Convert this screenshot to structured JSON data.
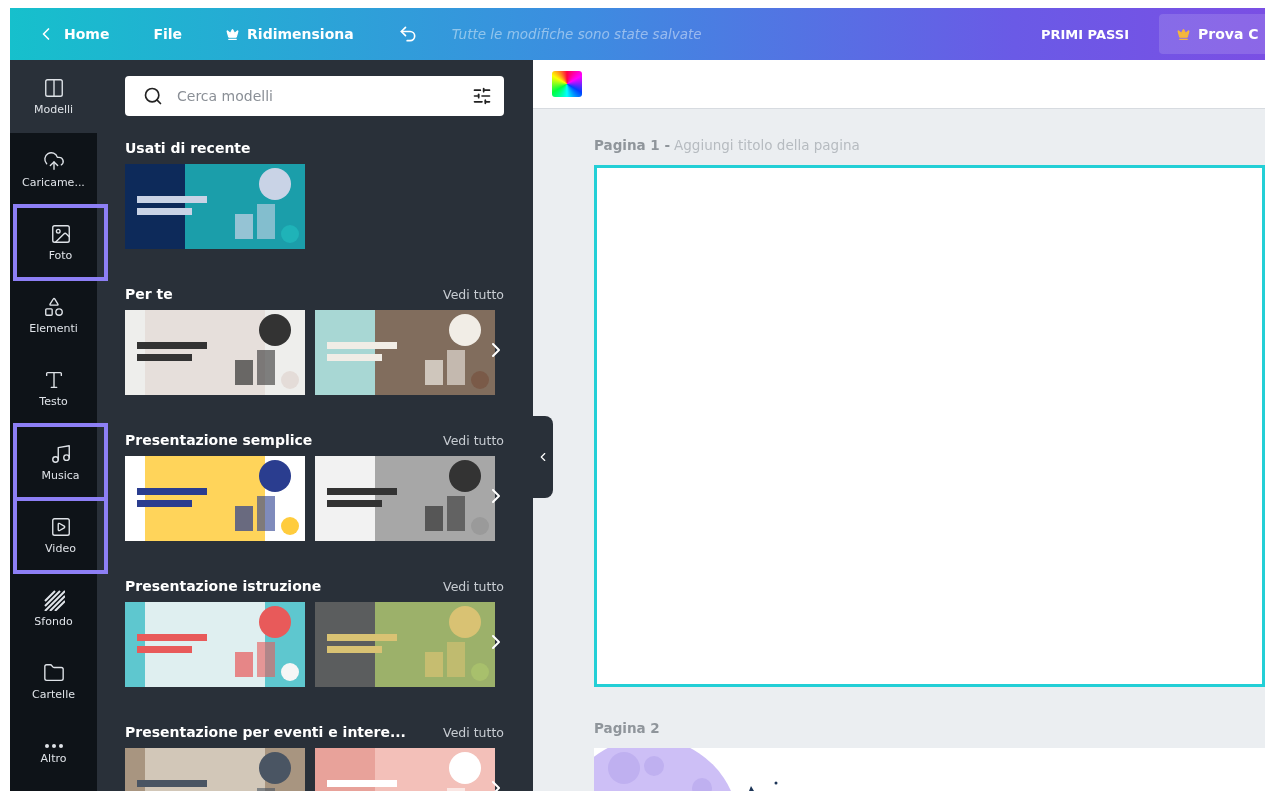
{
  "top_bar": {
    "back": "Home",
    "menu": [
      {
        "label": "File",
        "kind": "plain"
      },
      {
        "label": "Ridimensiona",
        "kind": "premium"
      }
    ],
    "status": "Tutte le modifiche sono state salvate",
    "help": "PRIMI PASSI",
    "trial": "Prova C"
  },
  "sidebar": {
    "items": [
      {
        "label": "Modelli",
        "kind": "templates",
        "selected": true,
        "highlighted": false
      },
      {
        "label": "Caricame...",
        "kind": "uploads",
        "selected": false,
        "highlighted": false
      },
      {
        "label": "Foto",
        "kind": "photos",
        "selected": false,
        "highlighted": true
      },
      {
        "label": "Elementi",
        "kind": "elements",
        "selected": false,
        "highlighted": false
      },
      {
        "label": "Testo",
        "kind": "text",
        "selected": false,
        "highlighted": false
      },
      {
        "label": "Musica",
        "kind": "music",
        "selected": false,
        "highlighted": true
      },
      {
        "label": "Video",
        "kind": "video",
        "selected": false,
        "highlighted": true
      },
      {
        "label": "Sfondo",
        "kind": "background",
        "selected": false,
        "highlighted": false
      },
      {
        "label": "Cartelle",
        "kind": "folders",
        "selected": false,
        "highlighted": false
      },
      {
        "label": "Altro",
        "kind": "more",
        "selected": false,
        "highlighted": false
      }
    ]
  },
  "panel": {
    "search": {
      "placeholder": "Cerca modelli"
    },
    "sections": [
      {
        "title": "Usati di recente"
      },
      {
        "title": "Per te",
        "see_all": "Vedi tutto"
      },
      {
        "title": "Presentazione semplice",
        "see_all": "Vedi tutto"
      },
      {
        "title": "Presentazione istruzione",
        "see_all": "Vedi tutto"
      },
      {
        "title": "Presentazione per eventi e intere...",
        "see_all": "Vedi tutto"
      }
    ]
  },
  "canvas": {
    "pages": [
      {
        "label": "Pagina 1 -",
        "title_placeholder": "Aggiungi titolo della pagina",
        "selected": true
      },
      {
        "label": "Pagina 2",
        "selected": false
      }
    ]
  }
}
